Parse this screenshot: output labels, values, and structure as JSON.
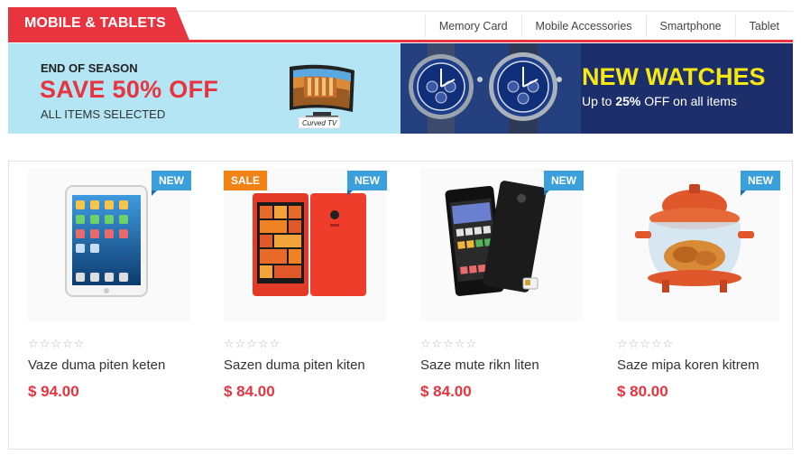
{
  "category": {
    "title": "MOBILE & TABLETS"
  },
  "nav": {
    "items": [
      "Memory Card",
      "Mobile Accessories",
      "Smartphone",
      "Tablet"
    ]
  },
  "banner_left": {
    "eyebrow": "END OF SEASON",
    "headline": "SAVE 50% OFF",
    "sub": "ALL ITEMS SELECTED",
    "tv_brand": "Curved TV"
  },
  "banner_right": {
    "title": "NEW WATCHES",
    "sub_prefix": "Up to ",
    "sub_strong": "25%",
    "sub_suffix": " OFF on all items"
  },
  "stars_glyphs": "☆☆☆☆☆",
  "products": [
    {
      "name": "Vaze duma piten keten",
      "price": "$ 94.00",
      "badges": [
        "NEW"
      ],
      "image": "tablet-icon"
    },
    {
      "name": "Sazen duma piten kiten",
      "price": "$ 84.00",
      "badges": [
        "SALE",
        "NEW"
      ],
      "image": "smartphone-red-icon"
    },
    {
      "name": "Saze mute rikn liten",
      "price": "$ 84.00",
      "badges": [
        "NEW"
      ],
      "image": "smartphone-black-icon"
    },
    {
      "name": "Saze mipa koren kitrem",
      "price": "$ 80.00",
      "badges": [
        "NEW"
      ],
      "image": "halogen-oven-icon"
    }
  ],
  "colors": {
    "accent": "#e8343f",
    "new_badge": "#3a9fdb",
    "sale_badge": "#f08216",
    "banner_left_bg": "#b3e5f4",
    "banner_right_bg": "#1d2f6b",
    "watch_title": "#f7e713"
  }
}
